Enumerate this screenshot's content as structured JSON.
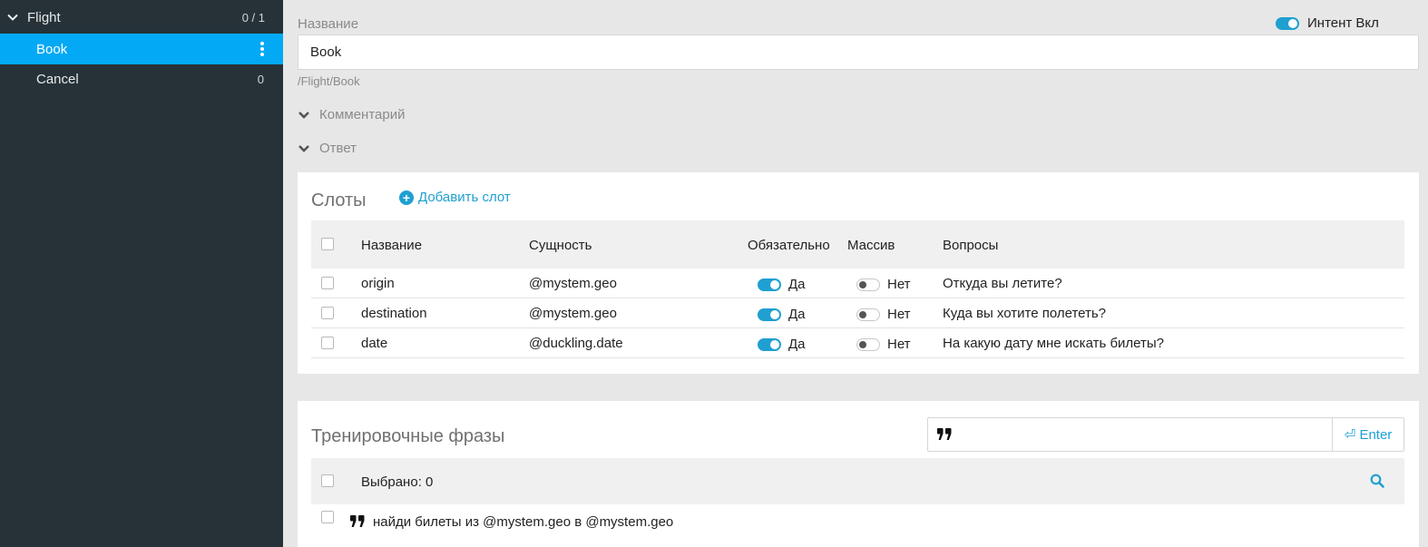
{
  "sidebar": {
    "group": {
      "label": "Flight",
      "count": "0 / 1",
      "icon": "chevron-down-icon"
    },
    "items": [
      {
        "label": "Book",
        "selected": true,
        "icon": "kebab-menu-icon"
      },
      {
        "label": "Cancel",
        "count": "0"
      }
    ]
  },
  "intent": {
    "name_label": "Название",
    "name_value": "Book",
    "path": "/Flight/Book",
    "toggle_label": "Интент Вкл",
    "toggle_on": true,
    "comment_label": "Комментарий",
    "answer_label": "Ответ"
  },
  "slots": {
    "title": "Слоты",
    "add_label": "Добавить слот",
    "headers": {
      "name": "Название",
      "entity": "Сущность",
      "required": "Обязательно",
      "array": "Массив",
      "questions": "Вопросы"
    },
    "rows": [
      {
        "name": "origin",
        "entity": "@mystem.geo",
        "required": "Да",
        "array": "Нет",
        "question": "Откуда вы летите?"
      },
      {
        "name": "destination",
        "entity": "@mystem.geo",
        "required": "Да",
        "array": "Нет",
        "question": "Куда вы хотите полететь?"
      },
      {
        "name": "date",
        "entity": "@duckling.date",
        "required": "Да",
        "array": "Нет",
        "question": "На какую дату мне искать билеты?"
      }
    ]
  },
  "training": {
    "title": "Тренировочные фразы",
    "input_value": "",
    "enter_label": "⏎ Enter",
    "selected_label": "Выбрано: 0",
    "phrases": [
      {
        "text": "найди билеты из @mystem.geo в @mystem.geo"
      }
    ]
  },
  "colors": {
    "sidebar_bg": "#263238",
    "selected_bg": "#03a9f4",
    "accent": "#1fa0d1",
    "page_bg": "#e7e7e7"
  }
}
